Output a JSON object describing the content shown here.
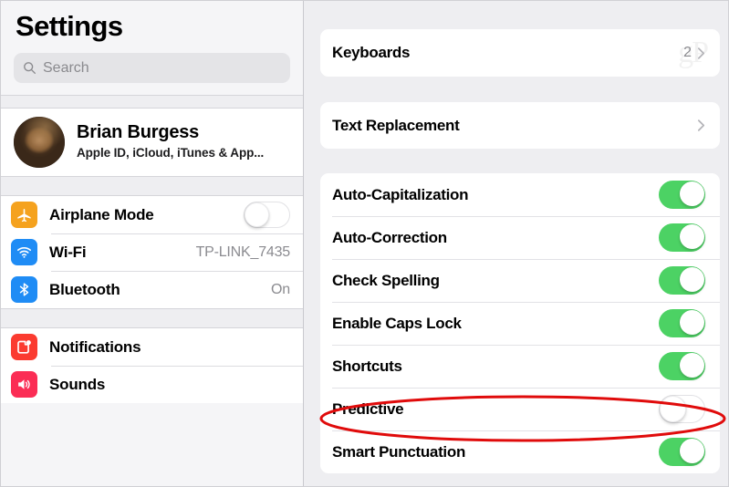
{
  "sidebar": {
    "title": "Settings",
    "search": {
      "placeholder": "Search",
      "icon": "search-icon"
    },
    "profile": {
      "name": "Brian Burgess",
      "subtitle": "Apple ID, iCloud, iTunes & App...",
      "avatar_icon": "avatar"
    },
    "groups": [
      {
        "items": [
          {
            "label": "Airplane Mode",
            "icon": "airplane-icon",
            "icon_color": "#f5a21e",
            "control": "toggle",
            "value": "off"
          },
          {
            "label": "Wi-Fi",
            "icon": "wifi-icon",
            "icon_color": "#1f8cf5",
            "control": "value",
            "value": "TP-LINK_7435"
          },
          {
            "label": "Bluetooth",
            "icon": "bluetooth-icon",
            "icon_color": "#1f8cf5",
            "control": "value",
            "value": "On"
          }
        ]
      },
      {
        "items": [
          {
            "label": "Notifications",
            "icon": "notifications-icon",
            "icon_color": "#fb3b30",
            "control": "none",
            "value": ""
          },
          {
            "label": "Sounds",
            "icon": "sounds-icon",
            "icon_color": "#fb2d55",
            "control": "none",
            "value": ""
          }
        ]
      }
    ]
  },
  "main": {
    "cards": [
      {
        "rows": [
          {
            "label": "Keyboards",
            "control": "disclosure",
            "value": "2",
            "watermark": "gP",
            "chevron_icon": "chevron-right-icon"
          }
        ]
      },
      {
        "rows": [
          {
            "label": "Text Replacement",
            "control": "disclosure",
            "value": "",
            "chevron_icon": "chevron-right-icon"
          }
        ]
      },
      {
        "rows": [
          {
            "label": "Auto-Capitalization",
            "control": "toggle",
            "value": "on"
          },
          {
            "label": "Auto-Correction",
            "control": "toggle",
            "value": "on"
          },
          {
            "label": "Check Spelling",
            "control": "toggle",
            "value": "on"
          },
          {
            "label": "Enable Caps Lock",
            "control": "toggle",
            "value": "on"
          },
          {
            "label": "Shortcuts",
            "control": "toggle",
            "value": "on"
          },
          {
            "label": "Predictive",
            "control": "toggle",
            "value": "off",
            "highlighted": true
          },
          {
            "label": "Smart Punctuation",
            "control": "toggle",
            "value": "on"
          }
        ]
      }
    ]
  },
  "annotation": {
    "type": "ellipse",
    "color": "#e00b0b",
    "target": "Predictive"
  },
  "colors": {
    "toggle_on": "#4cd264",
    "annotation_red": "#e00b0b",
    "panel_bg": "#eeeef1",
    "sidebar_bg": "#f5f5f7"
  }
}
